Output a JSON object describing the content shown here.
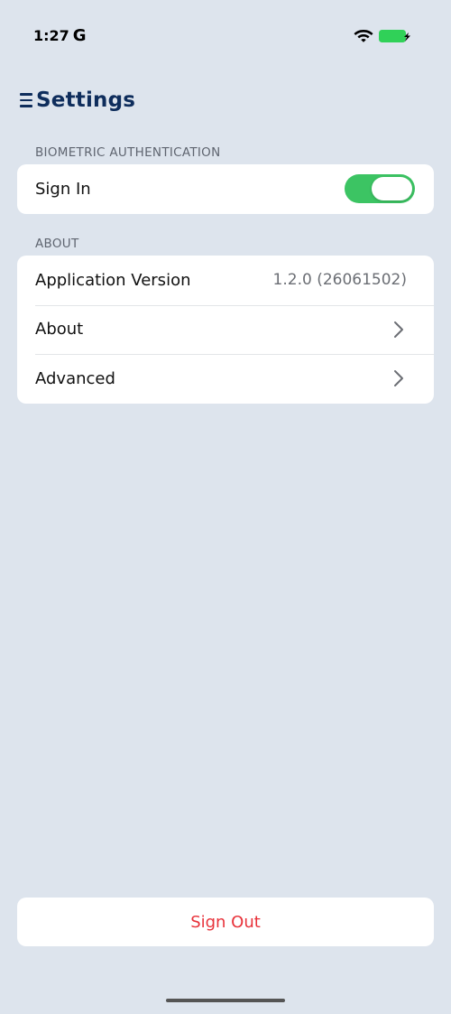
{
  "status_bar": {
    "time": "1:27",
    "carrier_icon": "G",
    "icons": [
      "wifi-icon",
      "battery-charging-icon"
    ],
    "battery_color": "#30d158"
  },
  "header": {
    "menu_icon": "menu-icon",
    "title": "Settings",
    "title_color": "#0e2d5c"
  },
  "sections": {
    "biometric": {
      "header": "BIOMETRIC AUTHENTICATION",
      "sign_in_label": "Sign In",
      "sign_in_enabled": true,
      "toggle_color": "#3cc463"
    },
    "about": {
      "header": "ABOUT",
      "app_version_label": "Application Version",
      "app_version_value": "1.2.0 (26061502)",
      "about_label": "About",
      "advanced_label": "Advanced"
    }
  },
  "sign_out": {
    "label": "Sign Out",
    "color": "#e8323a"
  }
}
